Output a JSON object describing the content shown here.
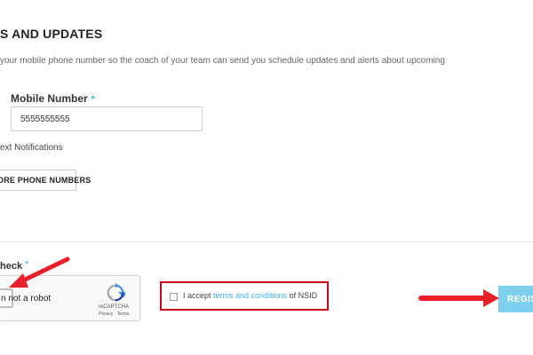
{
  "section": {
    "title": "S AND UPDATES",
    "description": "your mobile phone number so the coach of your team can send you schedule updates and alerts about upcoming"
  },
  "mobile": {
    "label": "Mobile Number",
    "required_mark": "*",
    "value": "5555555555"
  },
  "text_notifications": "ext Notifications",
  "more_phone_button": "ORE PHONE NUMBERS",
  "check": {
    "label": "heck",
    "required_mark": "*"
  },
  "recaptcha": {
    "label": "n not a robot",
    "brand": "reCAPTCHA",
    "links": "Privacy - Terms",
    "logo_icon": "recaptcha-logo-icon"
  },
  "terms": {
    "prefix": "I accept ",
    "link_text": "terms and conditions",
    "suffix": " of NSID"
  },
  "register_button": "REGIS",
  "colors": {
    "accent": "#3db3e3",
    "register_bg": "#7fcfee",
    "highlight_red": "#d0021b",
    "arrow_red": "#e8202a"
  }
}
